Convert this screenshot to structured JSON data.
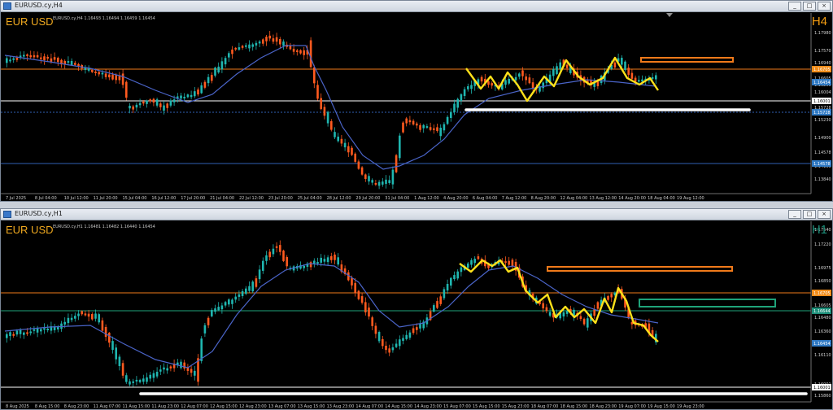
{
  "windows": [
    {
      "id": "h4",
      "title": "EURUSD.cy,H4",
      "symbol": "EUR USD",
      "timeframe": "H4",
      "tf_color": "#f39c12",
      "ohlc_text": "EURUSD.cy,H4 1.16493 1.16494 1.16459 1.16454",
      "price_labels": [
        "1.17980",
        "1.17570",
        "1.16940",
        "1.16705",
        "1.16605",
        "1.16250",
        "1.16004",
        "1.15930",
        "1.15728",
        "1.15560",
        "1.15230",
        "1.14900",
        "1.14578",
        "1.14160",
        "1.13840"
      ],
      "time_labels": [
        "7 Jul 2025",
        "8 Jul 04:00",
        "10 Jul 12:00",
        "11 Jul 20:00",
        "15 Jul 04:00",
        "16 Jul 12:00",
        "17 Jul 20:00",
        "21 Jul 04:00",
        "22 Jul 12:00",
        "23 Jul 20:00",
        "25 Jul 04:00",
        "28 Jul 12:00",
        "29 Jul 20:00",
        "31 Jul 04:00",
        "1 Aug 12:00",
        "4 Aug 20:00",
        "6 Aug 04:00",
        "7 Aug 12:00",
        "8 Aug 20:00",
        "12 Aug 04:00",
        "13 Aug 12:00",
        "14 Aug 20:00",
        "18 Aug 04:00",
        "19 Aug 12:00"
      ],
      "highlight_labels": [
        {
          "text": "1.16705",
          "color": "#f08c1a"
        },
        {
          "text": "1.16454",
          "color": "#2f79c3"
        },
        {
          "text": "1.16001",
          "color": "#ffffff"
        },
        {
          "text": "1.15728",
          "color": "#2f79c3"
        },
        {
          "text": "1.14578",
          "color": "#2f79c3"
        }
      ]
    },
    {
      "id": "h1",
      "title": "EURUSD.cy,H1",
      "symbol": "EUR USD",
      "timeframe": "H1",
      "tf_color": "#1d8f7a",
      "ohlc_text": "EURUSD.cy,H1 1.16481 1.16482 1.16440 1.16454",
      "price_labels": [
        "1.17540",
        "1.17220",
        "1.16975",
        "1.16850",
        "1.16725",
        "1.16605",
        "1.16480",
        "1.16360",
        "1.16235",
        "1.16110",
        "1.16001",
        "1.15860"
      ],
      "time_labels": [
        "8 Aug 2025",
        "8 Aug 15:00",
        "8 Aug 23:00",
        "11 Aug 07:00",
        "11 Aug 15:00",
        "11 Aug 23:00",
        "12 Aug 07:00",
        "12 Aug 15:00",
        "12 Aug 23:00",
        "13 Aug 07:00",
        "13 Aug 15:00",
        "13 Aug 23:00",
        "14 Aug 07:00",
        "14 Aug 15:00",
        "14 Aug 23:00",
        "15 Aug 07:00",
        "15 Aug 15:00",
        "15 Aug 23:00",
        "18 Aug 07:00",
        "18 Aug 15:00",
        "18 Aug 23:00",
        "19 Aug 07:00",
        "19 Aug 15:00",
        "19 Aug 23:00"
      ],
      "highlight_labels": [
        {
          "text": "1.16705",
          "color": "#f08c1a"
        },
        {
          "text": "1.16644",
          "color": "#1d8f7a"
        },
        {
          "text": "1.16454",
          "color": "#2f79c3"
        },
        {
          "text": "1.16001",
          "color": "#ffffff"
        }
      ]
    }
  ],
  "colors": {
    "bull": "#1fb6b0",
    "bear": "#ff5a1f",
    "ma": "#4a64c8",
    "zigzag": "#ffe11a",
    "orange_zone": "#f07a1a",
    "green_zone": "#1fa37a",
    "support": "#ffffff"
  },
  "icons": {
    "minimize": "minimize-icon",
    "maximize": "maximize-icon",
    "close": "close-icon"
  },
  "controls": {
    "min": "_",
    "max": "□",
    "close": "×"
  }
}
